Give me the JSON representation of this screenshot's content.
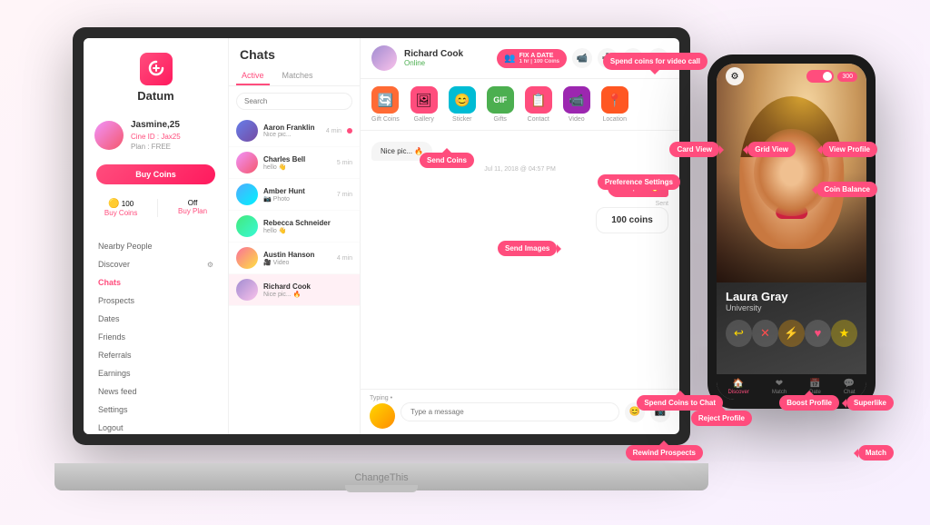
{
  "app": {
    "logo_text": "Datum",
    "bottom_label": "ChangeThis"
  },
  "sidebar": {
    "user_name": "Jasmine,25",
    "user_id": "Cine ID : Jax25",
    "user_plan": "Plan : FREE",
    "buy_coins_btn": "Buy Coins",
    "coins_value": "100",
    "coins_label": "Buy Coins",
    "off_label": "Off",
    "buy_plan_label": "Buy Plan",
    "nav_items": [
      {
        "label": "Nearby People",
        "active": false
      },
      {
        "label": "Discover",
        "active": false
      },
      {
        "label": "Chats",
        "active": true
      },
      {
        "label": "Prospects",
        "active": false
      },
      {
        "label": "Dates",
        "active": false
      },
      {
        "label": "Friends",
        "active": false
      },
      {
        "label": "Referrals",
        "active": false
      },
      {
        "label": "Earnings",
        "active": false
      },
      {
        "label": "News feed",
        "active": false
      },
      {
        "label": "Settings",
        "active": false
      },
      {
        "label": "Logout",
        "active": false
      }
    ]
  },
  "chat_list": {
    "title": "Chats",
    "tabs": [
      {
        "label": "Active",
        "active": true
      },
      {
        "label": "Matches",
        "active": false
      }
    ],
    "search_placeholder": "Search",
    "items": [
      {
        "name": "Aaron Franklin",
        "message": "Nice pic...",
        "time": "4 min",
        "has_dot": true
      },
      {
        "name": "Charles Bell",
        "message": "hello 👋",
        "time": "5 min",
        "has_dot": false
      },
      {
        "name": "Amber Hunt",
        "message": "Photo",
        "time": "7 min",
        "has_dot": false
      },
      {
        "name": "Rebecca Schneider",
        "message": "hello 👋",
        "time": "",
        "has_dot": false
      },
      {
        "name": "Austin Hanson",
        "message": "Video",
        "time": "4 min",
        "has_dot": false
      },
      {
        "name": "Richard Cook",
        "message": "Nice pic... 🔥",
        "time": "",
        "has_dot": false
      }
    ]
  },
  "conversation": {
    "contact_name": "Richard Cook",
    "contact_status": "Online",
    "fix_date_label": "FIX A DATE",
    "fix_date_sub": "1 hr | 100 Coins",
    "gift_items": [
      {
        "label": "Gift Coins",
        "emoji": "🔄"
      },
      {
        "label": "Gallery",
        "emoji": "🖼"
      },
      {
        "label": "Sticker",
        "emoji": "😊"
      },
      {
        "label": "Gifts",
        "emoji": "GIF"
      },
      {
        "label": "Contact",
        "emoji": "📋"
      },
      {
        "label": "Video",
        "emoji": "🎥"
      },
      {
        "label": "Location",
        "emoji": "📍"
      }
    ],
    "messages": [
      {
        "type": "received",
        "content": "Nice pic... 🔥"
      },
      {
        "type": "sent",
        "content": "Nice pic... 🔥"
      },
      {
        "type": "coins",
        "content": "100 coins",
        "label": "Sent"
      }
    ],
    "msg_date": "Jul 11, 2018 @ 04:57 PM",
    "typing_label": "Typing •",
    "input_placeholder": "Type a message"
  },
  "phone": {
    "user_name": "Laura Gray",
    "user_sub": "University",
    "nav_items": [
      {
        "label": "Discover",
        "icon": "🏠",
        "active": true
      },
      {
        "label": "Match",
        "icon": "❤",
        "active": false
      },
      {
        "label": "Date",
        "icon": "📅",
        "active": false
      },
      {
        "label": "Chat",
        "icon": "💬",
        "active": false
      }
    ],
    "action_btns": [
      "↩",
      "✕",
      "⚡",
      "♥",
      "★"
    ]
  },
  "tooltips": {
    "spend_coins_video": "Spend coins for\nvideo call",
    "send_coins": "Send Coins",
    "send_images": "Send Images",
    "card_view": "Card View",
    "grid_view": "Grid View",
    "view_profile": "View Profile",
    "preference_settings": "Preference Settings",
    "coin_balance": "Coin Balance",
    "spend_coins_chat": "Spend Coins to Chat",
    "reject_profile": "Reject Profile",
    "boost_profile": "Boost Profile",
    "superlike": "Superlike",
    "rewind_prospects": "Rewind Prospects",
    "match": "Match"
  }
}
